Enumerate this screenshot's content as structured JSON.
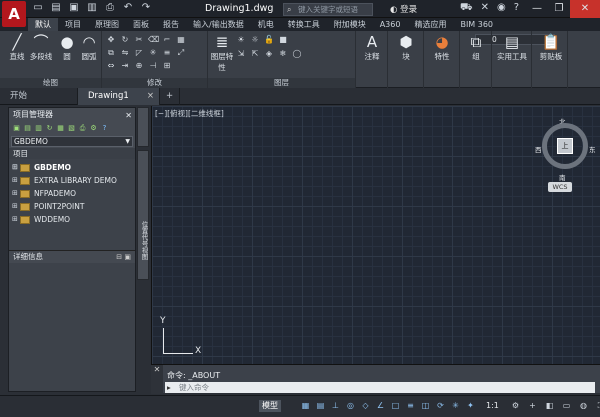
{
  "app": {
    "logo_letter": "A",
    "document_title": "Drawing1.dwg",
    "search_placeholder": "键入关键字或短语",
    "login_label": "登录",
    "window_controls": [
      "minimize-icon",
      "restore-icon",
      "close-icon"
    ]
  },
  "quick_access": [
    "new-icon",
    "open-icon",
    "save-icon",
    "save-as-icon",
    "print-icon",
    "undo-icon",
    "redo-icon"
  ],
  "ribbon_tabs": [
    "默认",
    "项目",
    "原理图",
    "面板",
    "报告",
    "输入/输出数据",
    "机电",
    "转换工具",
    "附加模块",
    "A360",
    "精选应用",
    "BIM 360"
  ],
  "ribbon_active_tab": "默认",
  "ribbon": {
    "draw": {
      "label": "绘图",
      "tools": [
        "直线",
        "多段线",
        "圆",
        "圆弧"
      ]
    },
    "modify": {
      "label": "修改"
    },
    "layer_panel_tool": "图层特性",
    "layers": {
      "label": "图层",
      "current_layer": "0"
    },
    "annotate": {
      "label": "注释"
    },
    "block": {
      "label": "块"
    },
    "properties": {
      "label": "特性"
    },
    "groups": {
      "label": "组"
    },
    "utilities": {
      "label": "实用工具"
    },
    "clipboard": {
      "label": "剪贴板"
    }
  },
  "file_tabs": {
    "start": "开始",
    "active": "Drawing1",
    "close_glyph": "×",
    "add_glyph": "+"
  },
  "project_manager": {
    "title": "项目管理器",
    "current_project": "GBDEMO",
    "section_projects": "项目",
    "projects": [
      "GBDEMO",
      "EXTRA LIBRARY DEMO",
      "NFPADEMO",
      "POINT2POINT",
      "WDDEMO"
    ],
    "details_title": "详细信息",
    "side_label": "位置代号视图"
  },
  "viewport": {
    "view_label": "[−][俯视][二维线框]",
    "viewcube": {
      "top": "北",
      "bottom": "南",
      "left": "西",
      "right": "东",
      "face": "上"
    },
    "wcs_label": "WCS",
    "ucs_x": "X",
    "ucs_y": "Y"
  },
  "command_line": {
    "history": "命令: _ABOUT",
    "prompt_glyph": "▸",
    "placeholder": "键入命令"
  },
  "status_bar": {
    "model_label": "模型",
    "scale_label": "1:1"
  }
}
